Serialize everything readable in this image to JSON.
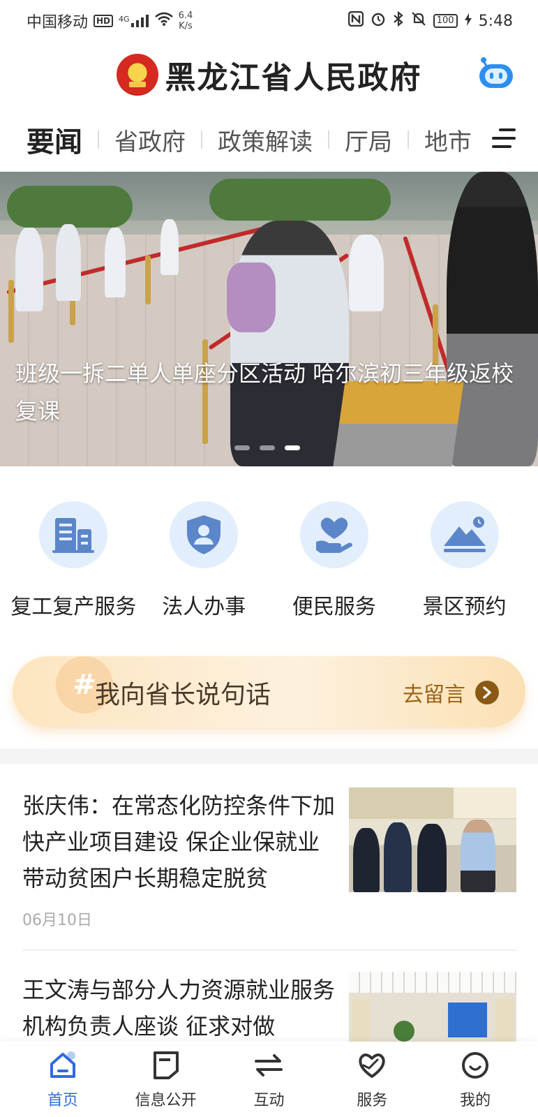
{
  "status_bar": {
    "carrier": "中国移动",
    "hd": "HD",
    "signal": "4G",
    "net_speed_value": "6.4",
    "net_speed_unit": "K/s",
    "battery": "100",
    "time": "5:48"
  },
  "header": {
    "title": "黑龙江省人民政府"
  },
  "tabs": [
    {
      "label": "要闻",
      "active": true
    },
    {
      "label": "省政府"
    },
    {
      "label": "政策解读"
    },
    {
      "label": "厅局"
    },
    {
      "label": "地市"
    }
  ],
  "banner": {
    "caption": "班级一拆二单人单座分区活动 哈尔滨初三年级返校复课",
    "dots": 3,
    "active_dot": 3
  },
  "services": [
    {
      "label": "复工复产服务",
      "icon": "building-icon"
    },
    {
      "label": "法人办事",
      "icon": "shield-person-icon"
    },
    {
      "label": "便民服务",
      "icon": "heart-hand-icon"
    },
    {
      "label": "景区预约",
      "icon": "mountain-clock-icon"
    }
  ],
  "message_banner": {
    "title": "我向省长说句话",
    "link": "去留言"
  },
  "news": [
    {
      "title": "张庆伟：在常态化防控条件下加快产业项目建设 保企业保就业带动贫困户长期稳定脱贫",
      "date": "06月10日"
    },
    {
      "title": "王文涛与部分人力资源就业服务机构负责人座谈 征求对做",
      "date": ""
    }
  ],
  "bottom_nav": [
    {
      "label": "首页",
      "active": true
    },
    {
      "label": "信息公开"
    },
    {
      "label": "互动"
    },
    {
      "label": "服务"
    },
    {
      "label": "我的"
    }
  ],
  "colors": {
    "accent": "#2f6bdf",
    "service_circle": "#e3eefc",
    "service_icon": "#5b86c9"
  }
}
